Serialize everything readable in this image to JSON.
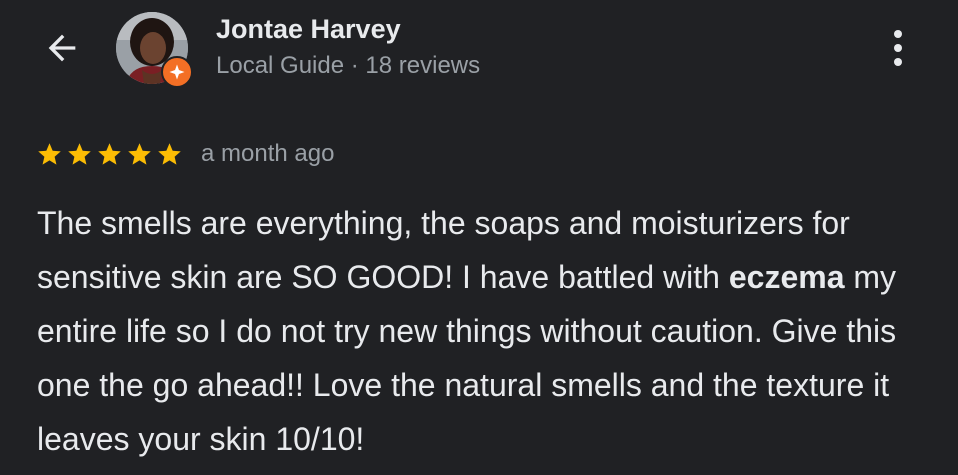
{
  "reviewer": {
    "name": "Jontae Harvey",
    "meta": "Local Guide · 18 reviews"
  },
  "icons": {
    "back": "arrow-back-icon",
    "more": "more-vert-icon",
    "badge": "local-guide-badge-icon",
    "star": "star-icon"
  },
  "review": {
    "rating": 5,
    "rating_max": 5,
    "date": "a month ago",
    "text_part1": "The smells are everything, the soaps and moisturizers for sensitive skin are SO GOOD! I have battled with ",
    "text_highlight": "eczema",
    "text_part2": " my entire life so I do not try new things without caution. Give this one the go ahead!! Love the natural smells and the texture it leaves your skin 10/10!"
  },
  "colors": {
    "background": "#202124",
    "star": "#fbbc04",
    "badge": "#f36f25",
    "primary_text": "#e8eaed",
    "secondary_text": "#9aa0a6"
  }
}
